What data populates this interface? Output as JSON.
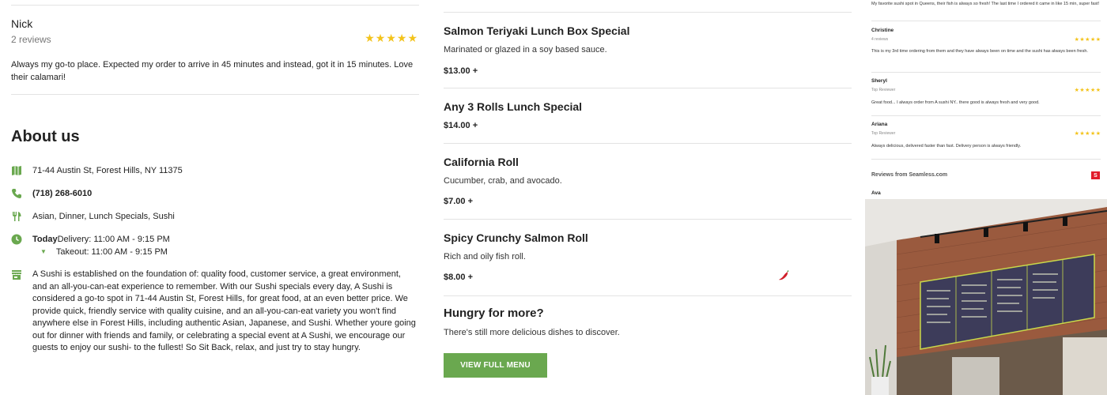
{
  "review": {
    "name": "Nick",
    "count": "2 reviews",
    "rating": 5,
    "text": "Always my go-to place. Expected my order to arrive in 45 minutes and instead, got it in 15 minutes. Love their calamari!"
  },
  "about": {
    "title": "About us",
    "address": "71-44 Austin St, Forest Hills, NY 11375",
    "phone": "(718) 268-6010",
    "categories": "Asian, Dinner, Lunch Specials, Sushi",
    "hours": {
      "today_label": "Today",
      "delivery": "Delivery: 11:00 AM - 9:15 PM",
      "takeout": "Takeout: 11:00 AM - 9:15 PM"
    },
    "description": "A Sushi is established on the foundation of: quality food, customer service, a great environment, and an all-you-can-eat experience to remember. With our Sushi specials every day, A Sushi is considered a go-to spot in 71-44 Austin St, Forest Hills, for great food, at an even better price. We provide quick, friendly service with quality cuisine, and an all-you-can-eat variety you won't find anywhere else in Forest Hills, including authentic Asian, Japanese, and Sushi. Whether youre going out for dinner with friends and family, or celebrating a special event at A Sushi, we encourage our guests to enjoy our sushi- to the fullest! So Sit Back, relax, and just try to stay hungry."
  },
  "menu": {
    "items": [
      {
        "title": "Salmon Teriyaki Lunch Box Special",
        "desc": "Marinated or glazed in a soy based sauce.",
        "price": "$13.00 +"
      },
      {
        "title": "Any 3 Rolls Lunch Special",
        "desc": "",
        "price": "$14.00 +"
      },
      {
        "title": "California Roll",
        "desc": "Cucumber, crab, and avocado.",
        "price": "$7.00 +"
      },
      {
        "title": "Spicy Crunchy Salmon Roll",
        "desc": "Rich and oily fish roll.",
        "price": "$8.00 +"
      }
    ],
    "more_title": "Hungry for more?",
    "more_sub": "There's still more delicious dishes to discover.",
    "button_label": "VIEW FULL MENU"
  },
  "side_reviews": {
    "top_text": "My favorite sushi spot in Queens, their fish is always so fresh! The last time I ordered it came in like 15 min, super fast!",
    "items": [
      {
        "name": "Christine",
        "sub": "4 reviews",
        "text": "This is my 3rd time ordering from them and they have always been on time and the sushi has always been fresh."
      },
      {
        "name": "Sheryl",
        "sub": "Top Reviewer",
        "text": "Great food... I always order from A sushi NY.. there good is always fresh and very good."
      },
      {
        "name": "Ariana",
        "sub": "Top Reviewer",
        "text": "Always delicious, delivered faster than fast. Delivery person is always friendly."
      }
    ],
    "seamless_title": "Reviews from Seamless.com",
    "seamless_logo": "S",
    "next_name": "Ava"
  },
  "colors": {
    "accent_green": "#6aa84f",
    "star_yellow": "#f3c31b",
    "seamless_red": "#e11d2c"
  },
  "icons": [
    "map-icon",
    "phone-icon",
    "utensils-icon",
    "clock-icon",
    "store-icon",
    "star-icon",
    "chili-icon"
  ]
}
